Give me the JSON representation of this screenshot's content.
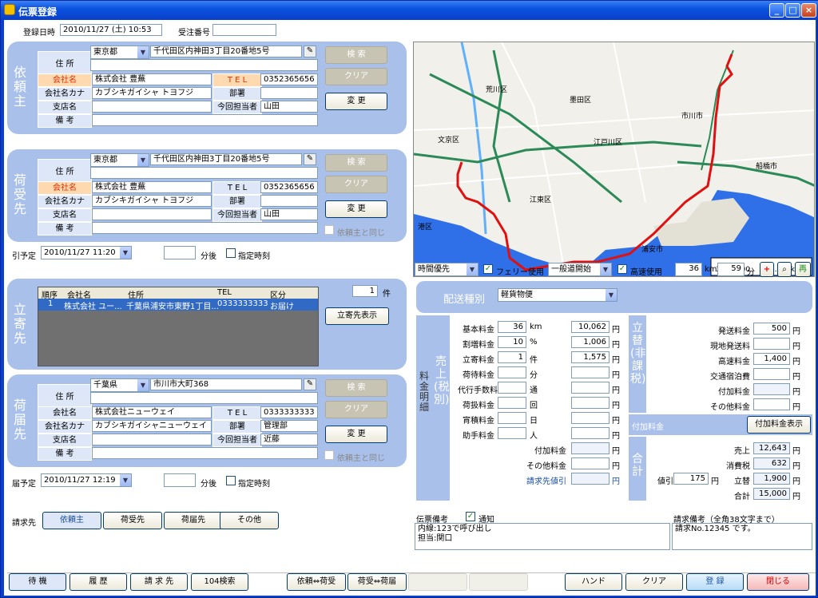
{
  "window": {
    "title": "伝票登録"
  },
  "header": {
    "reg_label": "登録日時",
    "reg_value": "2010/11/27 (土) 10:53",
    "recv_label": "受注番号",
    "recv_value": ""
  },
  "labels": {
    "address": "住 所",
    "company": "会社名",
    "kana": "会社名カナ",
    "branch": "支店名",
    "note": "備 考",
    "tel": "T E L",
    "dept": "部署",
    "person": "今回担当者",
    "search": "検 索",
    "clear": "クリア",
    "change": "変 更",
    "same": "依頼主と同じ"
  },
  "client": {
    "title": "依頼主",
    "pref": "東京都",
    "address": "千代田区内神田3丁目20番地5号",
    "company": "株式会社 豊蕪",
    "tel": "0352365656",
    "kana": "カブシキガイシャ トヨフジ",
    "dept": "",
    "branch": "",
    "person": "山田",
    "note": ""
  },
  "sender": {
    "title": "荷受先",
    "pref": "東京都",
    "address": "千代田区内神田3丁目20番地5号",
    "company": "株式会社 豊蕪",
    "tel": "0352365656",
    "kana": "カブシキガイシャ トヨフジ",
    "dept": "",
    "branch": "",
    "person": "山田",
    "note": ""
  },
  "pickup": {
    "label": "引予定",
    "value": "2010/11/27 11:20",
    "after": "分後",
    "spec": "指定時刻"
  },
  "stops": {
    "title": "立寄先",
    "count": "1",
    "count_unit": "件",
    "show_btn": "立寄先表示",
    "columns": [
      "順序",
      "会社名",
      "住所",
      "TEL",
      "区分"
    ],
    "rows": [
      [
        "1",
        "株式会社 ユー...",
        "千葉県浦安市東野1丁目...",
        "0333333333",
        "お届け"
      ]
    ]
  },
  "dest": {
    "title": "荷届先",
    "pref": "千葉県",
    "address": "市川市大町368",
    "company": "株式会社ニューウェイ",
    "tel": "0333333333",
    "kana": "カブシキガイシャニューウェイ",
    "dept": "管理部",
    "branch": "",
    "person": "近藤",
    "note": ""
  },
  "delivery": {
    "label": "届予定",
    "value": "2010/11/27 12:19",
    "after": "分後",
    "spec": "指定時刻"
  },
  "billing": {
    "label": "請求先",
    "tabs": [
      "依頼主",
      "荷受先",
      "荷届先",
      "その他"
    ]
  },
  "map": {
    "places": [
      "市川市",
      "江戸川区",
      "文京区",
      "荒川区",
      "墨田区",
      "江東区",
      "浦安市",
      "船橋市",
      "港区"
    ],
    "scale": "1/150000",
    "scale_dist": "6.000km"
  },
  "route": {
    "priority": "時間優先",
    "ferry": "フェリー使用",
    "general": "一般道開始",
    "highway": "高速使用",
    "km": "36",
    "km_unit": "km",
    "min": "59",
    "min_unit": "分",
    "rebtn": "再"
  },
  "delivery_type": {
    "label": "配送種別",
    "value": "軽貨物便"
  },
  "sales": {
    "v1": "料金明細",
    "v2": "売上(税別)",
    "rows": [
      {
        "label": "基本料金",
        "qty": "36",
        "unit": "km",
        "amount": "10,062"
      },
      {
        "label": "割増料金",
        "qty": "10",
        "unit": "%",
        "amount": "1,006"
      },
      {
        "label": "立寄料金",
        "qty": "1",
        "unit": "件",
        "amount": "1,575"
      },
      {
        "label": "荷待料金",
        "qty": "",
        "unit": "分",
        "amount": ""
      },
      {
        "label": "代行手数料",
        "qty": "",
        "unit": "通",
        "amount": ""
      },
      {
        "label": "荷扱料金",
        "qty": "",
        "unit": "回",
        "amount": ""
      },
      {
        "label": "宵積料金",
        "qty": "",
        "unit": "日",
        "amount": ""
      },
      {
        "label": "助手料金",
        "qty": "",
        "unit": "人",
        "amount": ""
      }
    ],
    "extra": [
      {
        "label": "付加料金",
        "amount": ""
      },
      {
        "label": "その他料金",
        "amount": ""
      },
      {
        "label": "請求先値引",
        "amount": ""
      }
    ],
    "yen": "円"
  },
  "advance": {
    "v": "立替(非課税)",
    "rows": [
      {
        "label": "発送料金",
        "amount": "500"
      },
      {
        "label": "現地発送料",
        "amount": ""
      },
      {
        "label": "高速料金",
        "amount": "1,400"
      },
      {
        "label": "交通宿泊費",
        "amount": ""
      },
      {
        "label": "付加料金",
        "amount": ""
      },
      {
        "label": "その他料金",
        "amount": ""
      }
    ]
  },
  "surcharge": {
    "label": "付加料金",
    "btn": "付加料金表示"
  },
  "totals": {
    "v": "合計",
    "rows": [
      {
        "label": "売上",
        "amount": "12,643"
      },
      {
        "label": "消費税",
        "amount": "632"
      },
      {
        "label": "立替",
        "amount": "1,900"
      },
      {
        "label": "合計",
        "amount": "15,000"
      }
    ],
    "disc_label": "値引",
    "disc": "175"
  },
  "notes": {
    "slip_label": "伝票備考",
    "notify": "通知",
    "slip_text1": "内線:123で呼び出し",
    "slip_text2": "担当:関口",
    "bill_label": "請求備考（全角38文字まで）",
    "bill_text": "請求No.12345 です。"
  },
  "footer": {
    "btns": [
      "待 機",
      "履 歴",
      "請 求 先",
      "104検索",
      "依頼⇔荷受",
      "荷受⇔荷届",
      "",
      "",
      "ハンド",
      "クリア",
      "登 録",
      "閉じる"
    ]
  }
}
